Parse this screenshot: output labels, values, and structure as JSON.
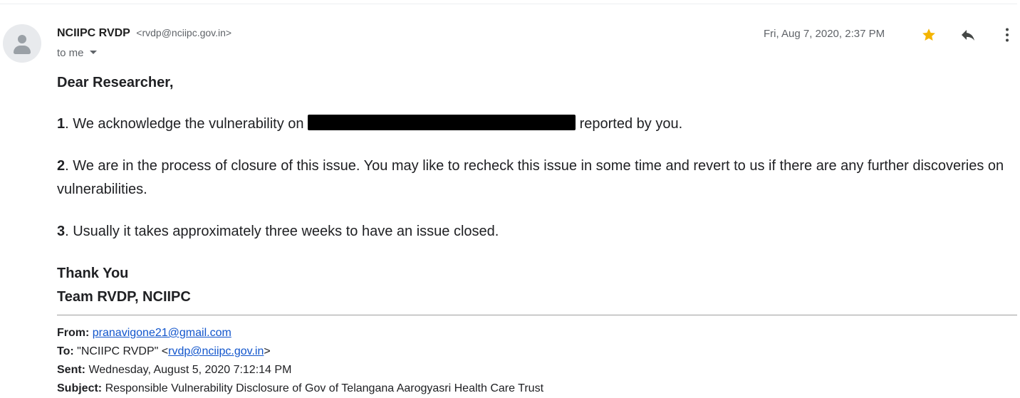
{
  "message": {
    "sender": {
      "name": "NCIIPC RVDP",
      "email": "<rvdp@nciipc.gov.in>"
    },
    "recipient_label": "to me",
    "date": "Fri, Aug 7, 2020, 2:37 PM",
    "icons": {
      "avatar": "person-icon",
      "star": "star-icon",
      "reply": "reply-icon",
      "more": "more-vert-icon"
    },
    "colors": {
      "star": "#f4b400",
      "link": "#1155cc",
      "secondary_text": "#5f6368"
    }
  },
  "body": {
    "greeting": "Dear Researcher,",
    "points": [
      {
        "num": "1",
        "pre": ". We acknowledge the vulnerability on ",
        "post": " reported by you."
      },
      {
        "num": "2",
        "text": ". We are in the process of closure of this issue. You may like to recheck this issue in some time and revert to us if there are any further discoveries on vulnerabilities."
      },
      {
        "num": "3",
        "text": ". Usually it takes approximately three weeks to have an issue closed."
      }
    ],
    "signoff": "Thank You",
    "team": "Team RVDP, NCIIPC"
  },
  "quoted": {
    "from_label": "From:",
    "from_email": "pranavigone21@gmail.com",
    "to_label": "To:",
    "to_name": "\"NCIIPC RVDP\" <",
    "to_email": "rvdp@nciipc.gov.in",
    "to_close": ">",
    "sent_label": "Sent:",
    "sent_value": "Wednesday, August 5, 2020 7:12:14 PM",
    "subject_label": "Subject:",
    "subject_value": "Responsible Vulnerability Disclosure of Gov of Telangana Aarogyasri Health Care Trust"
  }
}
